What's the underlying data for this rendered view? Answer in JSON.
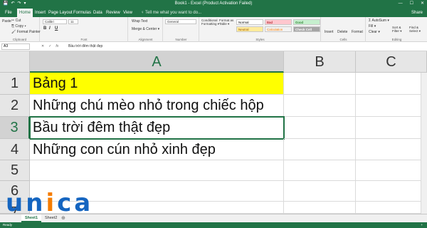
{
  "window": {
    "title": "Book1 - Excel (Product Activation Failed)",
    "controls": [
      "—",
      "☐",
      "✕"
    ]
  },
  "qat": [
    "💾",
    "↶",
    "↷",
    "▾"
  ],
  "tabs": [
    "File",
    "Home",
    "Insert",
    "Page Layout",
    "Formulas",
    "Data",
    "Review",
    "View"
  ],
  "tell_me": "♀ Tell me what you want to do...",
  "share": "Share",
  "ribbon": {
    "clipboard": {
      "paste": "Paste",
      "cut": "✂ Cut",
      "copy": "⎘ Copy ▾",
      "format_painter": "🖌 Format Painter",
      "label": "Clipboard"
    },
    "font": {
      "name": "Calibri",
      "size": "11",
      "label": "Font",
      "bold": "B",
      "italic": "I",
      "underline": "U"
    },
    "alignment": {
      "wrap": "Wrap Text",
      "merge": "Merge & Center ▾",
      "label": "Alignment"
    },
    "number": {
      "format": "General",
      "label": "Number"
    },
    "styles": {
      "conditional": "Conditional Formatting ▾",
      "format_table": "Format as Table ▾",
      "cells": [
        {
          "text": "Normal",
          "bg": "#ffffff",
          "fg": "#000000"
        },
        {
          "text": "Bad",
          "bg": "#ffc7ce",
          "fg": "#9c0006"
        },
        {
          "text": "Good",
          "bg": "#c6efce",
          "fg": "#006100"
        },
        {
          "text": "Neutral",
          "bg": "#ffeb9c",
          "fg": "#9c5700"
        },
        {
          "text": "Calculation",
          "bg": "#f2f2f2",
          "fg": "#fa7d00"
        },
        {
          "text": "Check Cell",
          "bg": "#a5a5a5",
          "fg": "#ffffff"
        }
      ],
      "label": "Styles"
    },
    "cells_group": {
      "insert": "Insert",
      "delete": "Delete",
      "format": "Format",
      "label": "Cells"
    },
    "editing": {
      "autosum": "Σ AutoSum ▾",
      "fill": "Fill ▾",
      "clear": "Clear ▾",
      "sort": "Sort & Filter ▾",
      "find": "Find & Select ▾",
      "label": "Editing"
    }
  },
  "formula_bar": {
    "name_box": "A3",
    "fx": "fx",
    "content": "Bầu trời đêm thật đẹp"
  },
  "columns": [
    "A",
    "B",
    "C"
  ],
  "rows": [
    {
      "num": "1",
      "a": "Bảng 1"
    },
    {
      "num": "2",
      "a": "Những chú mèo nhỏ trong chiếc hộp"
    },
    {
      "num": "3",
      "a": "Bầu trời đêm thật đẹp"
    },
    {
      "num": "4",
      "a": "Những con cún nhỏ xinh đẹp"
    },
    {
      "num": "5",
      "a": ""
    },
    {
      "num": "6",
      "a": ""
    },
    {
      "num": "7",
      "a": ""
    }
  ],
  "sheets": [
    "Sheet1",
    "Sheet2"
  ],
  "status": {
    "ready": "Ready",
    "zoom": "+"
  },
  "logo": {
    "letters": [
      "u",
      "n",
      "i",
      "c",
      "a"
    ],
    "colors": [
      "#1565c0",
      "#1565c0",
      "#f57c00",
      "#1565c0",
      "#1565c0"
    ]
  }
}
